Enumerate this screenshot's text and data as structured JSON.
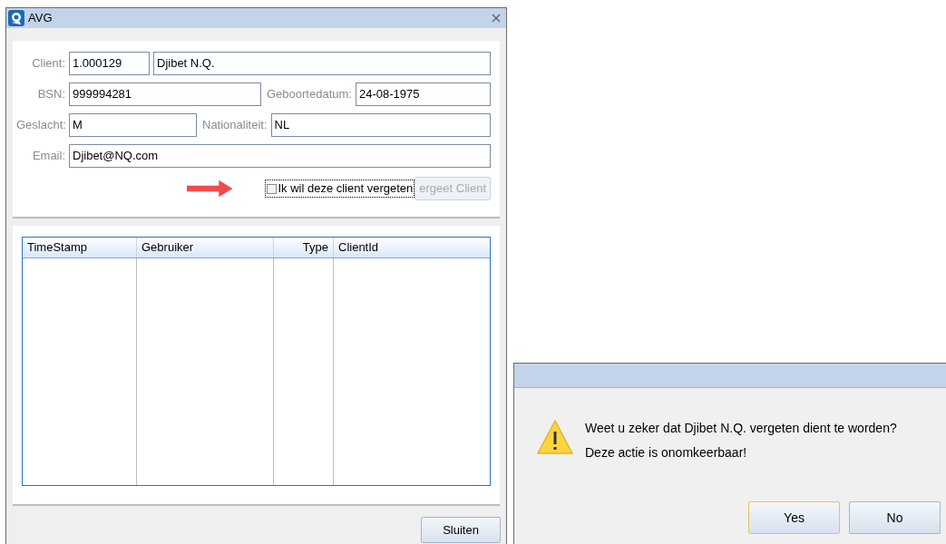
{
  "main_window": {
    "title": "AVG",
    "form_rows": [
      {
        "fields": [
          {
            "label": "Client:",
            "value": "1.000129"
          },
          {
            "value": "Djibet N.Q."
          }
        ]
      },
      {
        "fields": [
          {
            "label": "BSN:",
            "value": "999994281"
          },
          {
            "label": "Geboortedatum:",
            "value": "24-08-1975"
          }
        ]
      },
      {
        "fields": [
          {
            "label": "Geslacht:",
            "value": "M"
          },
          {
            "label": "Nationaliteit:",
            "value": "NL"
          }
        ]
      },
      {
        "fields": [
          {
            "label": "Email:",
            "value": "Djibet@NQ.com"
          }
        ]
      }
    ],
    "checkbox": {
      "label": "Ik wil deze client vergeten",
      "checked": false
    },
    "forget_button": {
      "label": "ergeet Client",
      "disabled": true
    },
    "table": {
      "columns": [
        "TimeStamp",
        "Gebruiker",
        "Type",
        "ClientId"
      ]
    },
    "close_button": {
      "label": "Sluiten",
      "disabled": false
    }
  },
  "dialog": {
    "message": [
      "Weet u zeker dat Djibet N.Q. vergeten dient te worden?",
      "Deze actie is onomkeerbaar!"
    ],
    "buttons": [
      {
        "label": "Yes",
        "default": true
      },
      {
        "label": "No",
        "default": false
      }
    ]
  }
}
